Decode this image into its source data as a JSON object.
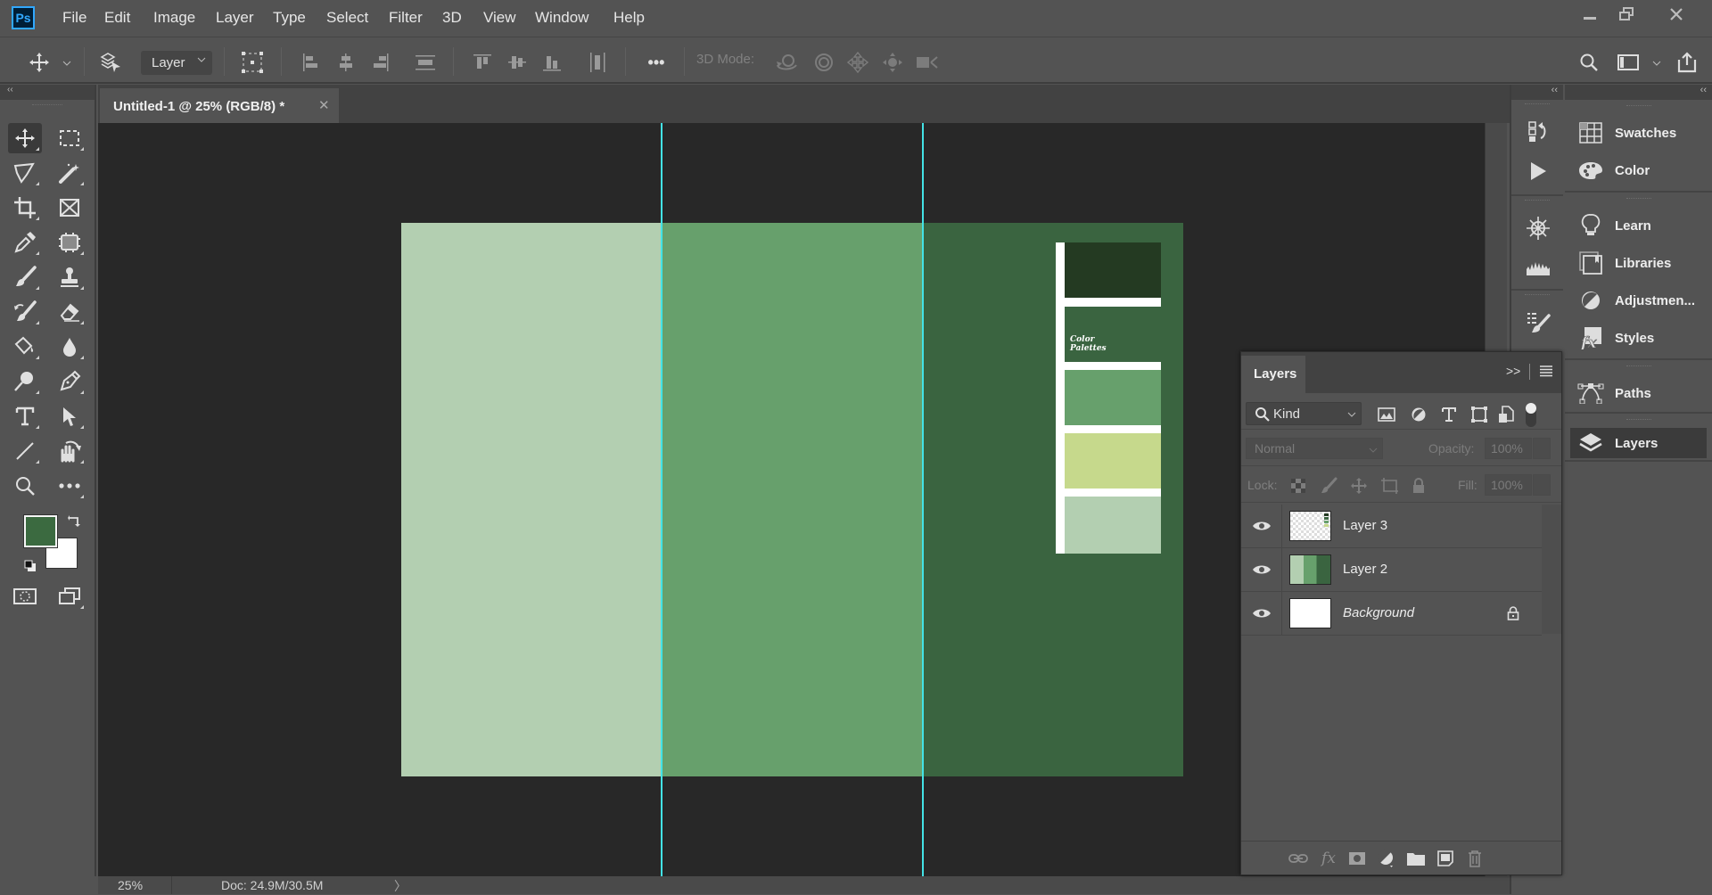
{
  "app": {
    "logo": "Ps",
    "name": "Adobe Photoshop"
  },
  "menu": [
    "File",
    "Edit",
    "Image",
    "Layer",
    "Type",
    "Select",
    "Filter",
    "3D",
    "View",
    "Window",
    "Help"
  ],
  "window_controls": [
    "minimize",
    "restore",
    "close"
  ],
  "options_bar": {
    "auto_select_target": "Layer",
    "mode3d_label": "3D Mode:",
    "more_label": "•••"
  },
  "document": {
    "tab_title": "Untitled-1 @ 25% (RGB/8) *",
    "zoom": "25%",
    "doc_size": "Doc: 24.9M/30.5M",
    "status_arrow": "〉"
  },
  "colors": {
    "foreground": "#3b6a40",
    "background": "#ffffff",
    "guide": "#43e3e6",
    "panel_light": "#b3cfb1",
    "panel_mid": "#67a06c",
    "panel_dark": "#3a6440"
  },
  "artwork": {
    "palette_title_line1": "Color",
    "palette_title_line2": "Palettes",
    "swatches": [
      "#243a22",
      "#3a6440",
      "#67a06c",
      "#c6d98c",
      "#b3cfb1"
    ]
  },
  "toolbar": {
    "collapse": "‹‹",
    "tools": [
      [
        "move-tool",
        "marquee-tool"
      ],
      [
        "lasso-tool",
        "magic-wand-tool"
      ],
      [
        "crop-tool",
        "frame-tool"
      ],
      [
        "eyedropper-tool",
        "spot-healing-tool"
      ],
      [
        "brush-tool",
        "clone-stamp-tool"
      ],
      [
        "history-brush-tool",
        "eraser-tool"
      ],
      [
        "paint-bucket-tool",
        "blur-tool"
      ],
      [
        "dodge-tool",
        "pen-tool"
      ],
      [
        "type-tool",
        "path-selection-tool"
      ],
      [
        "line-tool",
        "hand-tool"
      ],
      [
        "zoom-tool",
        "edit-toolbar"
      ]
    ]
  },
  "icon_strip": {
    "collapse": "‹‹",
    "items": [
      "history",
      "actions",
      "brush-settings-wheel",
      "histogram",
      "brush-presets",
      "clone-source"
    ]
  },
  "right_panel": {
    "collapse": "‹‹",
    "groups": [
      [
        {
          "label": "Swatches",
          "icon": "swatches-icon"
        },
        {
          "label": "Color",
          "icon": "palette-icon"
        }
      ],
      [
        {
          "label": "Learn",
          "icon": "lightbulb-icon"
        },
        {
          "label": "Libraries",
          "icon": "libraries-icon"
        },
        {
          "label": "Adjustmen...",
          "icon": "adjustments-icon"
        },
        {
          "label": "Styles",
          "icon": "fx-icon"
        }
      ],
      [
        {
          "label": "Paths",
          "icon": "paths-icon"
        }
      ],
      [
        {
          "label": "Layers",
          "icon": "layers-icon",
          "active": true
        }
      ]
    ]
  },
  "layers_panel": {
    "title": "Layers",
    "expand": ">>",
    "filter_kind": "Kind",
    "blend_mode": "Normal",
    "opacity_label": "Opacity:",
    "opacity_value": "100%",
    "lock_label": "Lock:",
    "fill_label": "Fill:",
    "fill_value": "100%",
    "layers": [
      {
        "name": "Layer 3",
        "visible": true,
        "locked": false,
        "italic": false,
        "thumb": "transparent-palette"
      },
      {
        "name": "Layer 2",
        "visible": true,
        "locked": false,
        "italic": false,
        "thumb": "three-greens"
      },
      {
        "name": "Background",
        "visible": true,
        "locked": true,
        "italic": true,
        "thumb": "white"
      }
    ]
  }
}
